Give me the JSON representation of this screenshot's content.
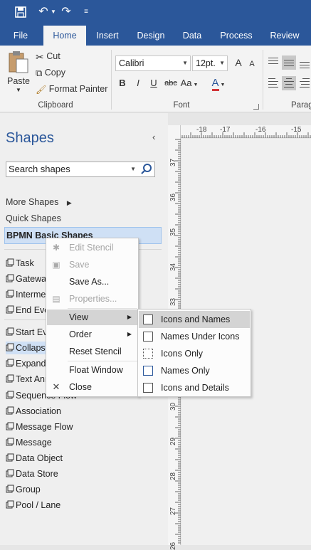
{
  "ribbon_tabs": [
    "File",
    "Home",
    "Insert",
    "Design",
    "Data",
    "Process",
    "Review"
  ],
  "active_tab": "Home",
  "clipboard": {
    "paste": "Paste",
    "cut": "Cut",
    "copy": "Copy",
    "format_painter": "Format Painter",
    "label": "Clipboard"
  },
  "font": {
    "family": "Calibri",
    "size": "12pt.",
    "bold": "B",
    "italic": "I",
    "underline": "U",
    "strike": "abc",
    "case": "Aa",
    "color": "A",
    "label": "Font",
    "grow": "A",
    "shrink": "A"
  },
  "paragraph_label": "Parag",
  "shapes_pane": {
    "title": "Shapes",
    "collapse_icon": "chevron-left-icon",
    "search_placeholder": "Search shapes",
    "more_shapes": "More Shapes",
    "quick_shapes": "Quick Shapes",
    "stencil": "BPMN Basic Shapes",
    "shapes": [
      "Task",
      "Gateway",
      "Intermediate Event",
      "End Event",
      "Start Event",
      "Collapsed Sub-Process",
      "Expanded Sub-Process",
      "Text Annotation",
      "Sequence Flow",
      "Association",
      "Message Flow",
      "Message",
      "Data Object",
      "Data Store",
      "Group",
      "Pool / Lane"
    ]
  },
  "ruler": {
    "h": [
      "-18",
      "-17",
      "-16",
      "-15"
    ],
    "v": [
      "37",
      "36",
      "35",
      "34",
      "33",
      "32",
      "31",
      "30",
      "29",
      "28",
      "27",
      "26"
    ]
  },
  "context_menu": {
    "items": [
      "Edit Stencil",
      "Save",
      "Save As...",
      "Properties...",
      "View",
      "Order",
      "Reset Stencil",
      "Float Window",
      "Close"
    ]
  },
  "view_submenu": {
    "items": [
      "Icons and Names",
      "Names Under Icons",
      "Icons Only",
      "Names Only",
      "Icons and Details"
    ]
  },
  "colors": {
    "accent": "#2b579a",
    "selection": "#cfe0f5",
    "font_color_bar": "#d13438"
  }
}
